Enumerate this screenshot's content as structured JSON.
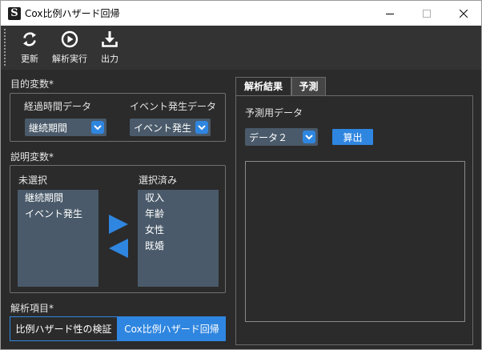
{
  "window": {
    "title": "Cox比例ハザード回帰",
    "app_icon": "S"
  },
  "toolbar": {
    "items": [
      {
        "label": "更新",
        "icon": "refresh-icon"
      },
      {
        "label": "解析実行",
        "icon": "play-icon"
      },
      {
        "label": "出力",
        "icon": "download-icon"
      }
    ]
  },
  "objective": {
    "section_label": "目的変数*",
    "time_label": "経過時間データ",
    "time_value": "継続期間",
    "event_label": "イベント発生データ",
    "event_value": "イベント発生"
  },
  "explanatory": {
    "section_label": "説明変数*",
    "unselected_label": "未選択",
    "unselected_items": [
      "継続期間",
      "イベント発生"
    ],
    "selected_label": "選択済み",
    "selected_items": [
      "収入",
      "年齢",
      "女性",
      "既婚"
    ]
  },
  "analysis": {
    "section_label": "解析項目*",
    "options": [
      {
        "label": "比例ハザード性の検証",
        "selected": false
      },
      {
        "label": "Cox比例ハザード回帰",
        "selected": true
      }
    ]
  },
  "tabs": [
    {
      "label": "解析結果",
      "active": false
    },
    {
      "label": "予測",
      "active": true
    }
  ],
  "prediction": {
    "data_label": "予測用データ",
    "data_value": "データ２",
    "calc_button": "算出"
  },
  "colors": {
    "accent": "#2f86e0",
    "background": "#2b2b2b",
    "field": "#4a5a6a"
  }
}
